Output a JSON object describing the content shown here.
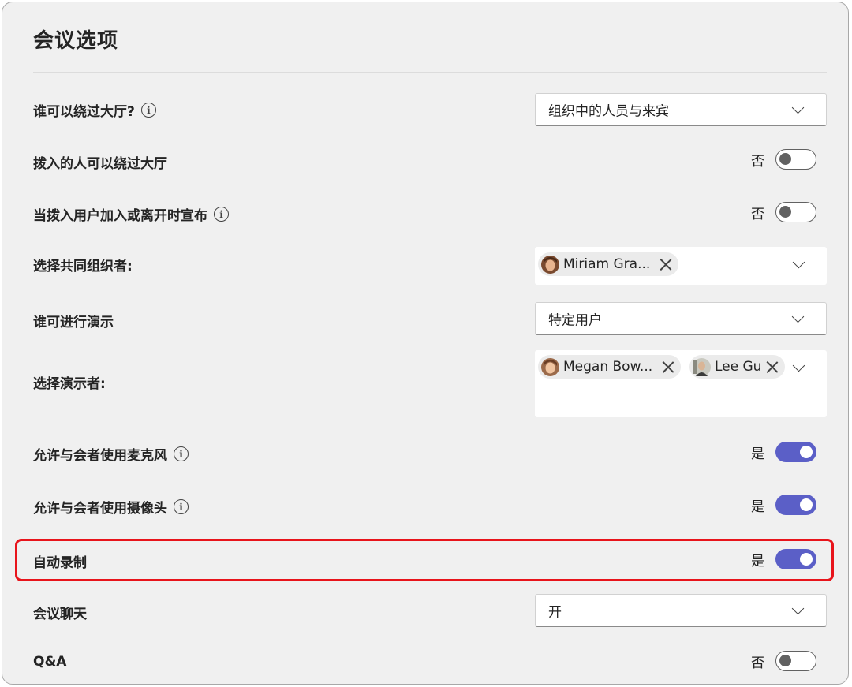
{
  "title": "会议选项",
  "rows": {
    "bypass_lobby": {
      "label": "谁可以绕过大厅?",
      "value": "组织中的人员与来宾"
    },
    "dial_in_bypass": {
      "label": "拨入的人可以绕过大厅",
      "state_text": "否",
      "on": false
    },
    "announce": {
      "label": "当拨入用户加入或离开时宣布",
      "state_text": "否",
      "on": false
    },
    "co_organizers": {
      "label": "选择共同组织者:",
      "chips": [
        {
          "name": "Miriam Gra..."
        }
      ]
    },
    "who_presents": {
      "label": "谁可进行演示",
      "value": "特定用户"
    },
    "presenters": {
      "label": "选择演示者:",
      "chips": [
        {
          "name": "Megan Bow..."
        },
        {
          "name": "Lee Gu"
        }
      ]
    },
    "allow_mic": {
      "label": "允许与会者使用麦克风",
      "state_text": "是",
      "on": true
    },
    "allow_camera": {
      "label": "允许与会者使用摄像头",
      "state_text": "是",
      "on": true
    },
    "auto_record": {
      "label": "自动录制",
      "state_text": "是",
      "on": true
    },
    "meeting_chat": {
      "label": "会议聊天",
      "value": "开"
    },
    "qa": {
      "label": "Q&A",
      "state_text": "否",
      "on": false
    }
  },
  "info_icon_glyph": "i",
  "colors": {
    "toggle_on": "#5b5fc7",
    "highlight": "#e8141b",
    "panel_bg": "#f0f0f0"
  }
}
